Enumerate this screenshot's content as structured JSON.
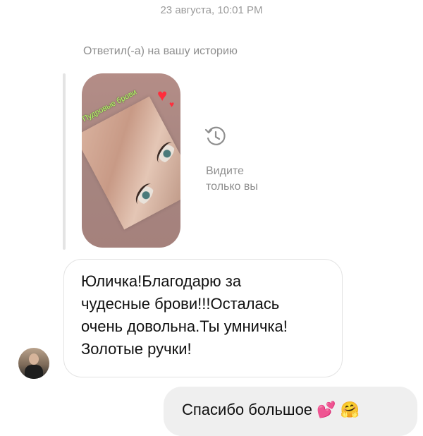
{
  "header": {
    "timestamp": "23 августа, 10:01 PM"
  },
  "story_reply": {
    "label": "Ответил(-а) на вашу историю",
    "story_caption": "Пудровые брови",
    "visibility_text_line1": "Видите",
    "visibility_text_line2": "только вы",
    "visibility_icon": "history-icon"
  },
  "incoming_message": {
    "lines": [
      "Юличка!Благодарю за",
      "чудесные брови!!!Осталась",
      "очень довольна.Ты умничка!",
      "Золотые ручки!"
    ]
  },
  "outgoing_message": {
    "text": "Спасибо большое",
    "emoji": [
      "💕",
      "🤗"
    ]
  },
  "colors": {
    "bubble_outgoing": "#efefef",
    "bubble_incoming_border": "#e3e3e3",
    "muted_text": "#8e8e8e",
    "caption_green": "#b8ff6a",
    "heart_red": "#ff2d3c"
  }
}
